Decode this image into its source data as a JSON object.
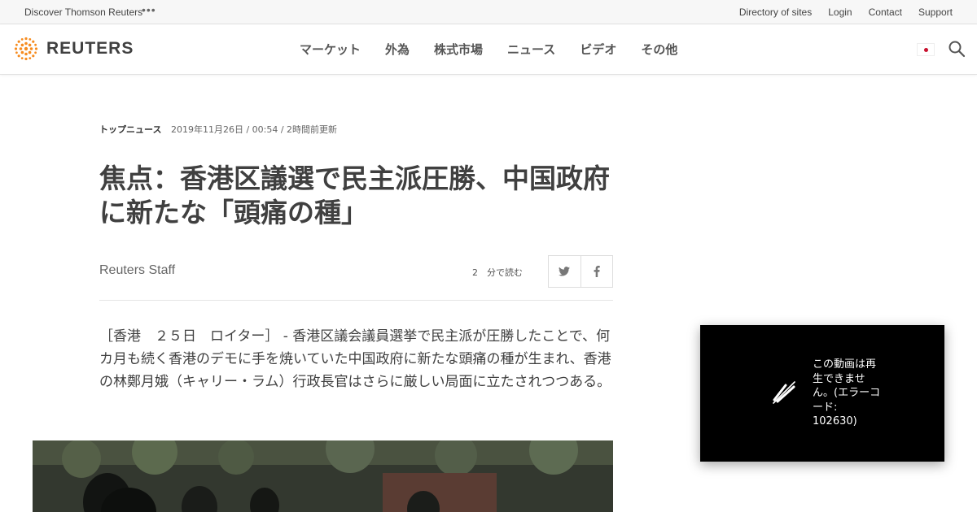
{
  "utility_bar": {
    "discover": "Discover Thomson Reuters",
    "more": "•••",
    "links": [
      "Directory of sites",
      "Login",
      "Contact",
      "Support"
    ]
  },
  "header": {
    "logo_text": "REUTERS",
    "nav": [
      "マーケット",
      "外為",
      "株式市場",
      "ニュース",
      "ビデオ",
      "その他"
    ],
    "flag": "japan-flag-icon",
    "search": "search-icon"
  },
  "article": {
    "kicker": "トップニュース",
    "timestamp": "2019年11月26日 / 00:54 / 2時間前更新",
    "title": "焦点：香港区議選で民主派圧勝、中国政府に新たな「頭痛の種」",
    "author": "Reuters Staff",
    "read_time": "2　分で読む",
    "share_icons": [
      "twitter-icon",
      "facebook-icon"
    ],
    "body": "［香港　２５日　ロイター］ - 香港区議会議員選挙で民主派が圧勝したことで、何カ月も続く香港のデモに手を焼いていた中国政府に新たな頭痛の種が生まれ、香港の林鄭月娥（キャリー・ラム）行政長官はさらに厳しい局面に立たされつつある。"
  },
  "video": {
    "icon": "video-unavailable-icon",
    "message": "この動画は再生できません。(エラーコード: 102630)"
  },
  "colors": {
    "text": "#404040",
    "logo_orange": "#f68b1f",
    "flag_red": "#c8102e"
  }
}
